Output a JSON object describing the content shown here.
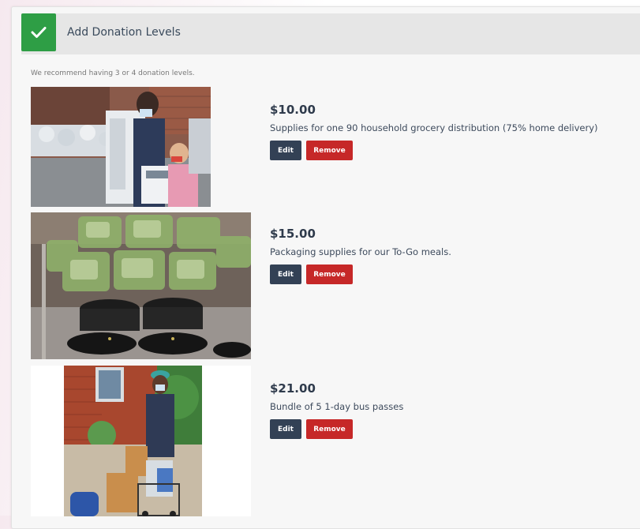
{
  "section": {
    "title": "Add Donation Levels",
    "hint": "We recommend having 3 or 4 donation levels.",
    "accent_color": "#2e9e45"
  },
  "buttons": {
    "edit_label": "Edit",
    "remove_label": "Remove"
  },
  "levels": [
    {
      "amount": "$10.00",
      "description": "Supplies for one 90 household grocery distribution (75% home delivery)"
    },
    {
      "amount": "$15.00",
      "description": "Packaging supplies for our To-Go meals."
    },
    {
      "amount": "$21.00",
      "description": "Bundle of 5 1-day bus passes"
    }
  ]
}
